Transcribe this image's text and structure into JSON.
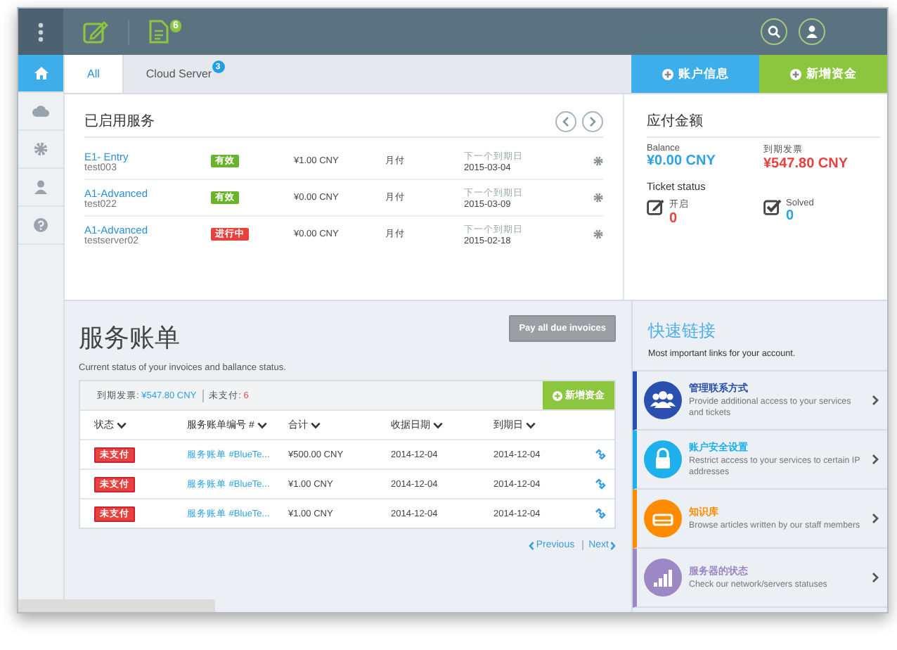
{
  "topbar": {
    "document_badge": "6"
  },
  "sidebar": {
    "items": [
      {
        "kind": "home",
        "selected": true
      },
      {
        "kind": "cloud",
        "selected": false
      },
      {
        "kind": "gear",
        "selected": false
      },
      {
        "kind": "user",
        "selected": false
      },
      {
        "kind": "help",
        "selected": false
      }
    ]
  },
  "tabs": [
    {
      "label": "All",
      "selected": true
    },
    {
      "label": "Cloud Server",
      "badge": "3",
      "selected": false
    }
  ],
  "action_buttons": [
    {
      "label": "账户信息",
      "color": "#3daee9"
    },
    {
      "label": "新增资金",
      "color": "#8cc63f"
    }
  ],
  "services": {
    "title": "已启用服务",
    "rows": [
      {
        "name": "E1- Entry",
        "host": "test003",
        "status": "有效",
        "color": "#6ab42d",
        "price": "¥1.00 CNY",
        "cycle": "月付",
        "due_label": "下一个到期日",
        "due": "2015-03-04"
      },
      {
        "name": "A1-Advanced",
        "host": "test022",
        "status": "有效",
        "color": "#6ab42d",
        "price": "¥0.00 CNY",
        "cycle": "月付",
        "due_label": "下一个到期日",
        "due": "2015-03-09"
      },
      {
        "name": "A1-Advanced",
        "host": "testserver02",
        "status": "进行中",
        "color": "#e8423f",
        "price": "¥0.00 CNY",
        "cycle": "月付",
        "due_label": "下一个到期日",
        "due": "2015-02-18"
      }
    ]
  },
  "amount_due": {
    "title": "应付金额",
    "balance_label": "Balance",
    "balance": "¥0.00 CNY",
    "due_label": "到期发票",
    "due": "¥547.80 CNY",
    "ticket_title": "Ticket status",
    "tickets": [
      {
        "kind": "open",
        "label": "开启",
        "count": "0",
        "color": "#e8423f"
      },
      {
        "kind": "solved",
        "label": "Solved",
        "count": "0",
        "color": "#2aa3e6"
      }
    ]
  },
  "invoices": {
    "title": "服务账单",
    "subtitle": "Current status of your invoices and ballance status.",
    "pay_button": "Pay all due invoices",
    "summary_label": "到期发票:",
    "summary_amount": "¥547.80 CNY",
    "unpaid_label": "未支付:",
    "unpaid_count": "6",
    "add_funds": "新增资金",
    "columns": [
      "状态",
      "服务账单编号 #",
      "合计",
      "收据日期",
      "到期日"
    ],
    "rows": [
      {
        "status": "未支付",
        "number": "服务账单 #BlueTe...",
        "total": "¥500.00 CNY",
        "date": "2014-12-04",
        "due": "2014-12-04"
      },
      {
        "status": "未支付",
        "number": "服务账单 #BlueTe...",
        "total": "¥1.00 CNY",
        "date": "2014-12-04",
        "due": "2014-12-04"
      },
      {
        "status": "未支付",
        "number": "服务账单 #BlueTe...",
        "total": "¥1.00 CNY",
        "date": "2014-12-04",
        "due": "2014-12-04"
      }
    ],
    "previous": "Previous",
    "next": "Next"
  },
  "quick_links": {
    "title": "快速链接",
    "subtitle": "Most important links for your account.",
    "items": [
      {
        "kind": "contacts",
        "title": "管理联系方式",
        "text": "Provide additional access to your services and tickets",
        "color": "#2b4fae"
      },
      {
        "kind": "lock",
        "title": "账户安全设置",
        "text": "Restrict access to your services to certain IP addresses",
        "color": "#1eb0ea"
      },
      {
        "kind": "drive",
        "title": "知识库",
        "text": "Browse articles written by our staff members",
        "color": "#ff8c00"
      },
      {
        "kind": "signal",
        "title": "服务器的状态",
        "text": "Check our network/servers statuses",
        "color": "#9b88c4"
      }
    ]
  }
}
